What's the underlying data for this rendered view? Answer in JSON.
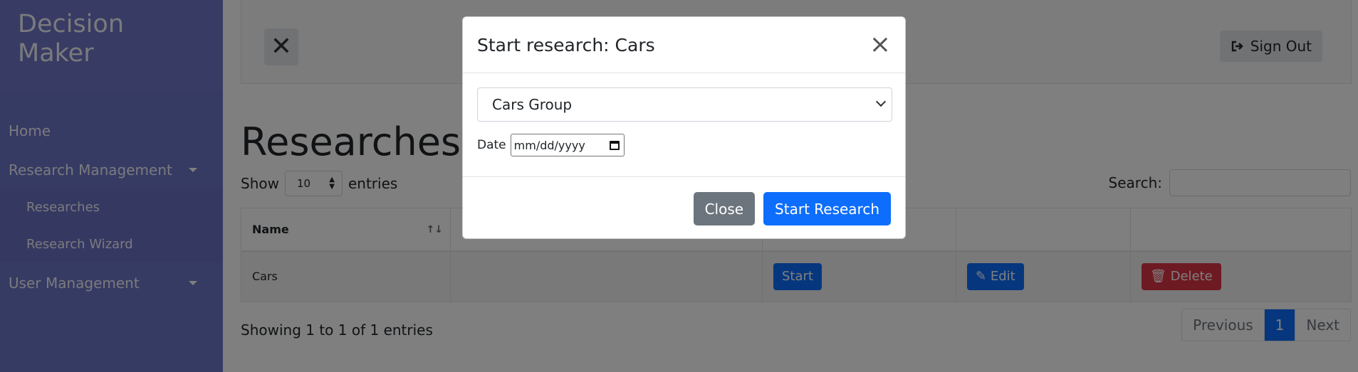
{
  "app": {
    "brand_line1": "Decision",
    "brand_line2": "Maker"
  },
  "sidebar": {
    "home": "Home",
    "research_management": "Research Management",
    "research_items": [
      "Researches",
      "Research Wizard"
    ],
    "user_management": "User Management"
  },
  "topbar": {
    "close_icon": "close-icon",
    "sign_out_label": "Sign Out"
  },
  "page": {
    "title": "Researches",
    "show_label": "Show",
    "entries_label": "entries",
    "page_length": "10",
    "search_label": "Search:",
    "search_value": ""
  },
  "table": {
    "headers": [
      "Name",
      "",
      "",
      "",
      ""
    ],
    "rows": [
      {
        "name": "Cars",
        "start": "Start",
        "edit": "Edit",
        "delete": "Delete"
      }
    ]
  },
  "footer": {
    "info": "Showing 1 to 1 of 1 entries",
    "previous": "Previous",
    "page": "1",
    "next": "Next"
  },
  "modal": {
    "title": "Start research: Cars",
    "group_select_value": "Cars Group",
    "date_label": "Date",
    "date_placeholder": "mm/dd/yyyy",
    "close_button": "Close",
    "start_button": "Start Research"
  },
  "colors": {
    "sidebar": "#6d76c8",
    "primary": "#0d6efd",
    "danger": "#dc3545",
    "secondary": "#6c757d"
  }
}
